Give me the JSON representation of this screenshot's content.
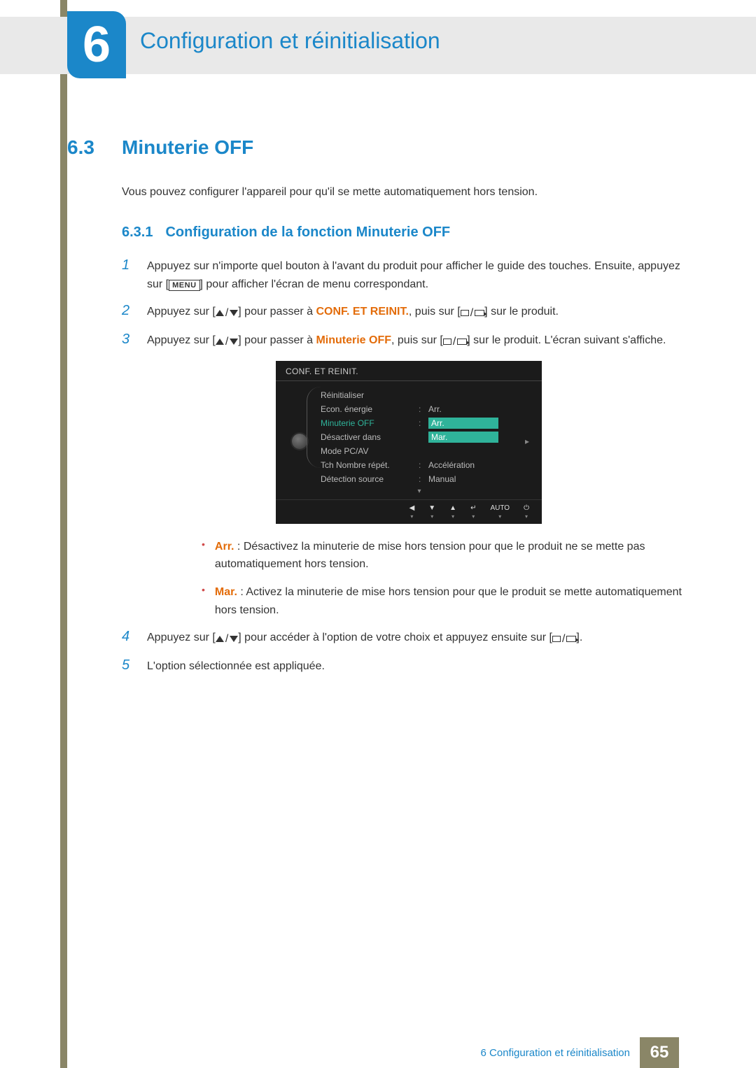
{
  "chapter": {
    "number": "6",
    "title": "Configuration et réinitialisation"
  },
  "section": {
    "number": "6.3",
    "title": "Minuterie OFF"
  },
  "intro": "Vous pouvez configurer l'appareil pour qu'il se mette automatiquement hors tension.",
  "subsection": {
    "number": "6.3.1",
    "title": "Configuration de la fonction Minuterie OFF"
  },
  "keys": {
    "menu": "MENU"
  },
  "steps": {
    "s1": {
      "num": "1",
      "a": "Appuyez sur n'importe quel bouton à l'avant du produit pour afficher le guide des touches. Ensuite, appuyez sur [",
      "b": "] pour afficher l'écran de menu correspondant."
    },
    "s2": {
      "num": "2",
      "a": "Appuyez sur [",
      "b": "] pour passer à ",
      "hl": "CONF. ET REINIT.",
      "c": ", puis sur [",
      "d": "] sur le produit."
    },
    "s3": {
      "num": "3",
      "a": "Appuyez sur [",
      "b": "] pour passer à ",
      "hl": "Minuterie OFF",
      "c": ", puis sur [",
      "d": "] sur le produit. L'écran suivant s'affiche."
    },
    "s4": {
      "num": "4",
      "a": "Appuyez sur [",
      "b": "] pour accéder à l'option de votre choix et appuyez ensuite sur [",
      "c": "]."
    },
    "s5": {
      "num": "5",
      "text": "L'option sélectionnée est appliquée."
    }
  },
  "osd": {
    "title": "CONF. ET REINIT.",
    "rows": {
      "reinit": "Réinitialiser",
      "econ": "Econ. énergie",
      "minuterie": "Minuterie OFF",
      "desact": "Désactiver dans",
      "mode": "Mode PC/AV",
      "tch": "Tch Nombre répét.",
      "detect": "Détection source"
    },
    "vals": {
      "econ": "Arr.",
      "opt1": "Arr.",
      "opt2": "Mar.",
      "tch": "Accélération",
      "detect": "Manual"
    },
    "footer": {
      "auto": "AUTO"
    }
  },
  "bullets": {
    "arr": {
      "label": "Arr.",
      "text": " : Désactivez la minuterie de mise hors tension pour que le produit ne se mette pas automatiquement hors tension."
    },
    "mar": {
      "label": "Mar.",
      "text": " : Activez la minuterie de mise hors tension pour que le produit se mette automatiquement hors tension."
    }
  },
  "footer": {
    "text": "6 Configuration et réinitialisation",
    "page": "65"
  }
}
